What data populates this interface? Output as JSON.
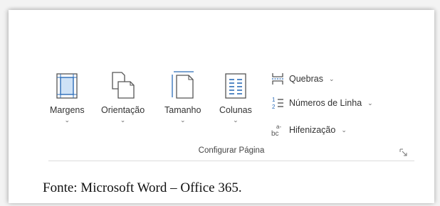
{
  "ribbon": {
    "group_label": "Configurar Página",
    "large_buttons": [
      {
        "label": "Margens",
        "icon": "margins-icon",
        "has_dropdown": true
      },
      {
        "label": "Orientação",
        "icon": "orientation-icon",
        "has_dropdown": true
      },
      {
        "label": "Tamanho",
        "icon": "size-icon",
        "has_dropdown": true
      },
      {
        "label": "Colunas",
        "icon": "columns-icon",
        "has_dropdown": true
      }
    ],
    "small_buttons": [
      {
        "label": "Quebras",
        "icon": "breaks-icon",
        "has_dropdown": true
      },
      {
        "label": "Números de Linha",
        "icon": "line-numbers-icon",
        "has_dropdown": true
      },
      {
        "label": "Hifenização",
        "icon": "hyphenation-icon",
        "has_dropdown": true
      }
    ],
    "dropdown_glyph": "⌄",
    "accent_color": "#2b6cb8"
  },
  "caption": "Fonte: Microsoft Word – Office 365."
}
